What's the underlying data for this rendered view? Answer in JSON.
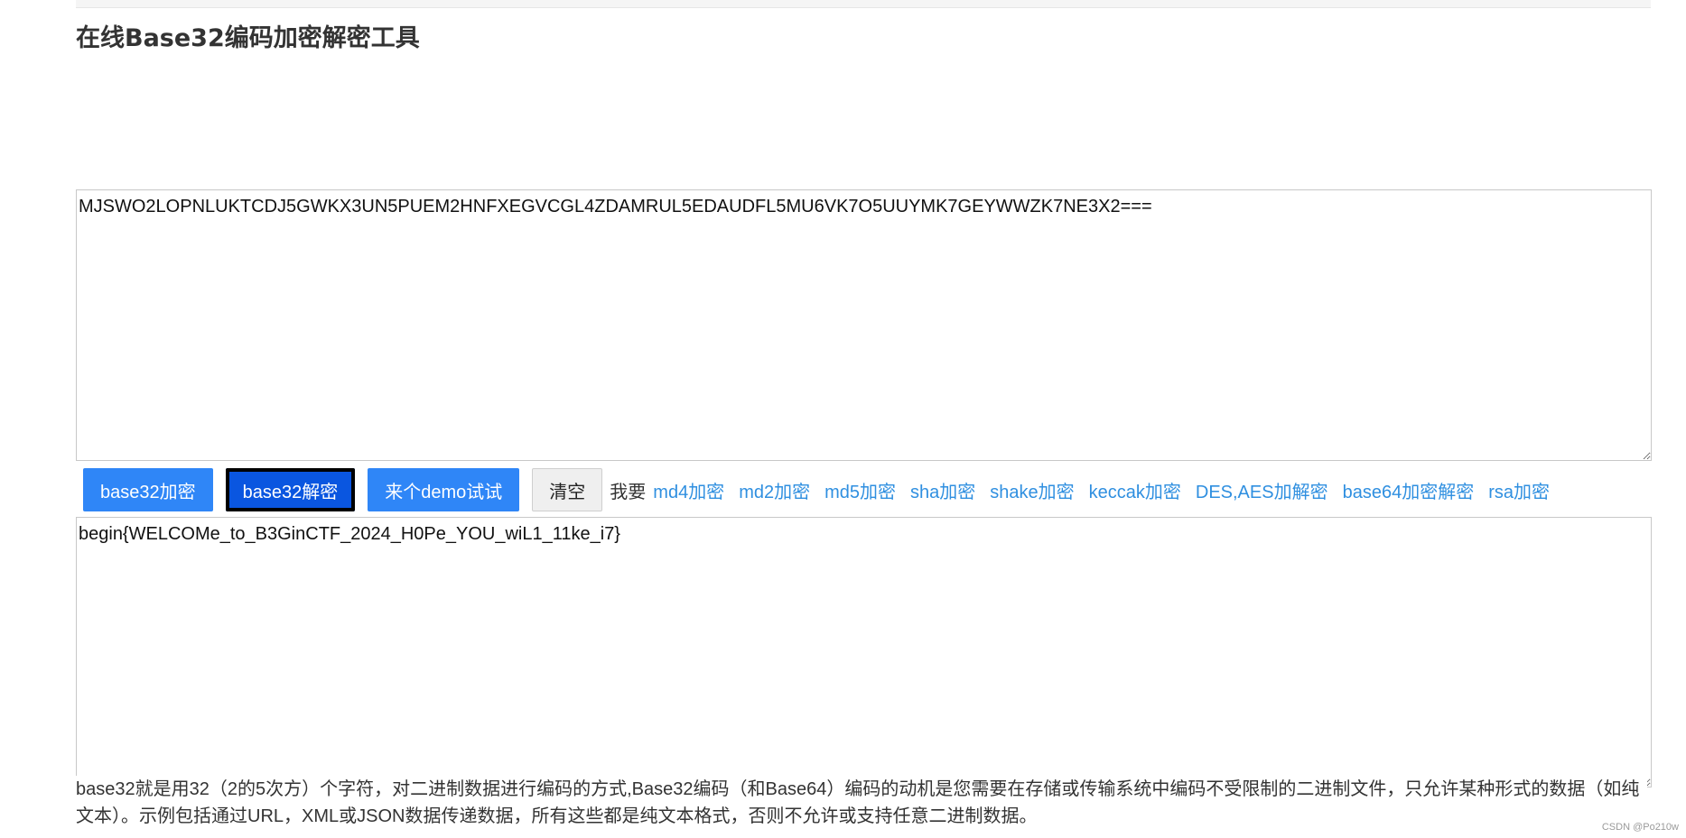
{
  "page": {
    "title": "在线Base32编码加密解密工具"
  },
  "input": {
    "value": "MJSWO2LOPNLUKTCDJ5GWKX3UN5PUEM2HNFXEGVCGL4ZDAMRUL5EDAUDFL5MU6VK7O5UUYMK7GEYWWZK7NE3X2==="
  },
  "toolbar": {
    "encode_label": "base32加密",
    "decode_label": "base32解密",
    "demo_label": "来个demo试试",
    "clear_label": "清空",
    "want_label": "我要",
    "links": [
      "md4加密",
      "md2加密",
      "md5加密",
      "sha加密",
      "shake加密",
      "keccak加密",
      "DES,AES加解密",
      "base64加密解密",
      "rsa加密"
    ]
  },
  "output": {
    "value": "begin{WELCOMe_to_B3GinCTF_2024_H0Pe_YOU_wiL1_11ke_i7}"
  },
  "description": "base32就是用32（2的5次方）个字符，对二进制数据进行编码的方式,Base32编码（和Base64）编码的动机是您需要在存储或传输系统中编码不受限制的二进制文件，只允许某种形式的数据（如纯文本）。示例包括通过URL，XML或JSON数据传递数据，所有这些都是纯文本格式，否则不允许或支持任意二进制数据。",
  "watermark": "CSDN @Po210w",
  "colors": {
    "primary_button": "#2f86f7",
    "active_button": "#0a56e0",
    "link": "#2f8fe0"
  }
}
